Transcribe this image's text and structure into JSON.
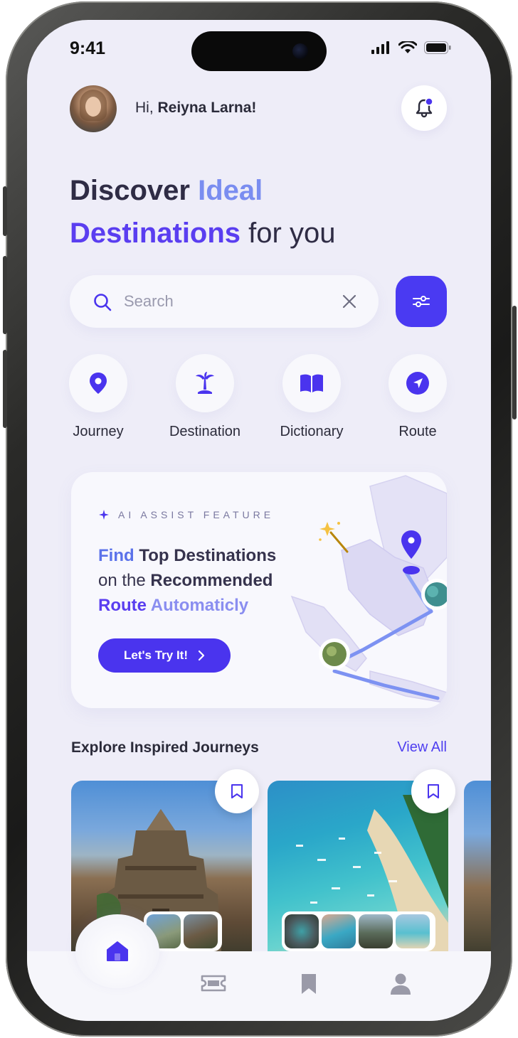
{
  "status_bar": {
    "time": "9:41"
  },
  "header": {
    "greeting_prefix": "Hi, ",
    "user_name": "Reiyna Larna!"
  },
  "headline": {
    "word1": "Discover ",
    "word2": "Ideal",
    "word3": "Destinations",
    "word4": " for you"
  },
  "search": {
    "placeholder": "Search",
    "value": ""
  },
  "categories": [
    {
      "label": "Journey",
      "icon": "location-pin-icon"
    },
    {
      "label": "Destination",
      "icon": "palm-tree-icon"
    },
    {
      "label": "Dictionary",
      "icon": "book-icon"
    },
    {
      "label": "Route",
      "icon": "navigation-arrow-icon"
    }
  ],
  "ai_card": {
    "tag": "AI ASSIST FEATURE",
    "line1_a": "Find",
    "line1_b": " Top Destinations",
    "line2_a": "on the ",
    "line2_b": "Recommended",
    "line3_a": "Route ",
    "line3_b": "Automaticly",
    "button_label": "Let's Try It!"
  },
  "journeys": {
    "title": "Explore Inspired Journeys",
    "view_all": "View All"
  },
  "colors": {
    "accent": "#4a34ee",
    "background": "#eeedf8",
    "headline_light": "#7a8df0",
    "text_dark": "#2f2c45"
  },
  "tab_bar": {
    "items": [
      {
        "icon": "home-icon",
        "active": true
      },
      {
        "icon": "ticket-icon",
        "active": false
      },
      {
        "icon": "bookmark-icon",
        "active": false
      },
      {
        "icon": "profile-icon",
        "active": false
      }
    ]
  }
}
